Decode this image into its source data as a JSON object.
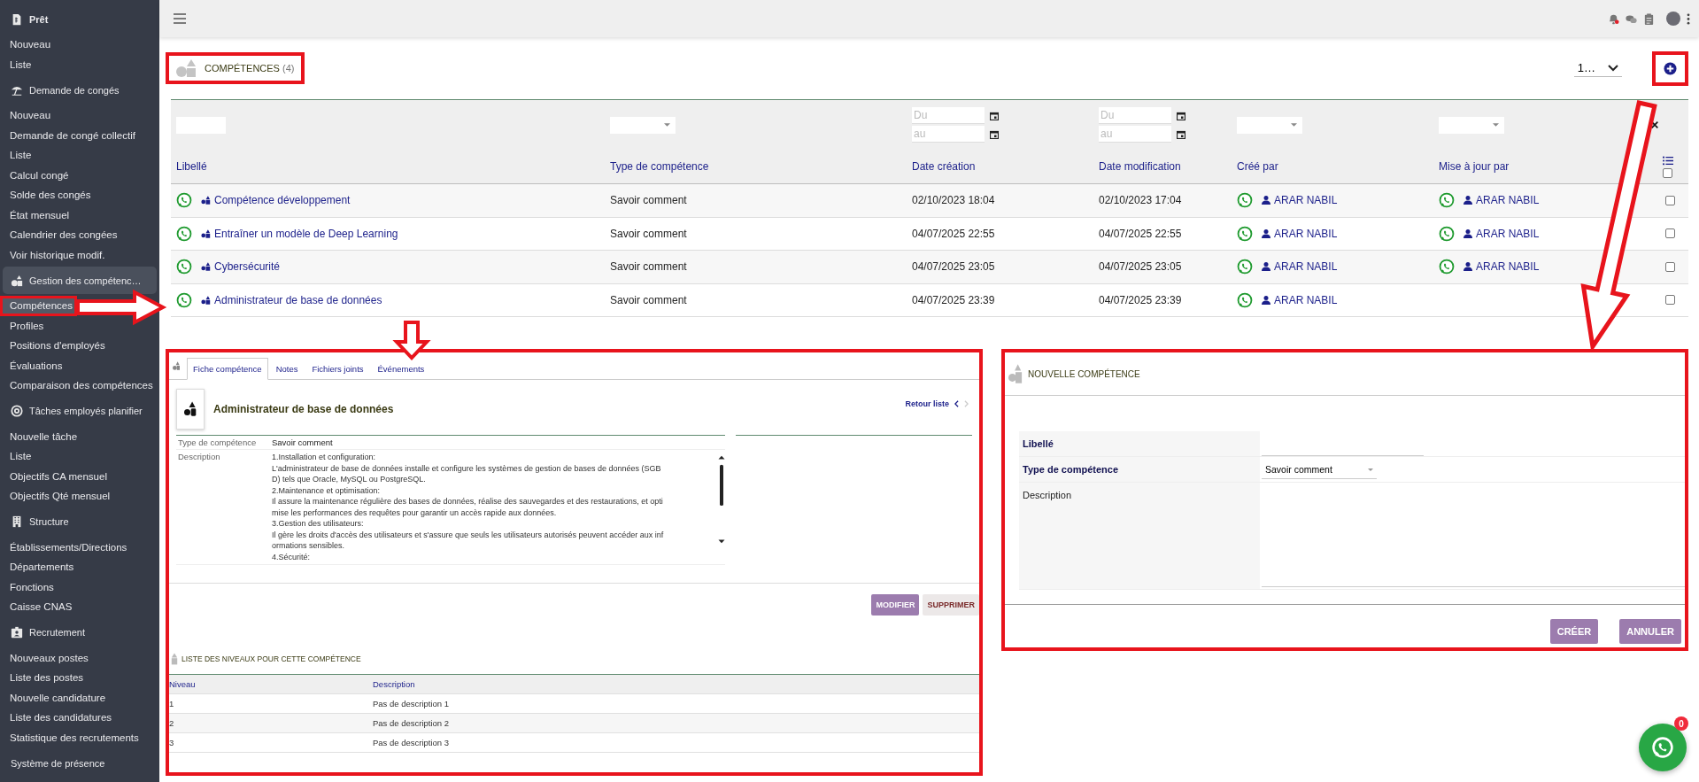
{
  "sidebar": {
    "sections": [
      {
        "kind": "document",
        "title": "Prêt",
        "active": false,
        "items": [
          {
            "label": "Nouveau",
            "selected": false
          },
          {
            "label": "Liste",
            "selected": false
          }
        ]
      },
      {
        "kind": "umbrella",
        "title": "Demande de congés",
        "active": false,
        "items": [
          {
            "label": "Nouveau",
            "selected": false
          },
          {
            "label": "Demande de congé collectif",
            "selected": false
          },
          {
            "label": "Liste",
            "selected": false
          },
          {
            "label": "Calcul congé",
            "selected": false
          },
          {
            "label": "Solde des congés",
            "selected": false
          },
          {
            "label": "État mensuel",
            "selected": false
          },
          {
            "label": "Calendrier des congées",
            "selected": false
          },
          {
            "label": "Voir historique modif.",
            "selected": false
          }
        ]
      },
      {
        "kind": "shapes",
        "title": "Gestion des compétenc…",
        "active": true,
        "items": [
          {
            "label": "Compétences",
            "selected": true
          },
          {
            "label": "Profiles",
            "selected": false
          },
          {
            "label": "Positions d'employés",
            "selected": false
          },
          {
            "label": "Évaluations",
            "selected": false
          },
          {
            "label": "Comparaison des compétences",
            "selected": false
          }
        ]
      },
      {
        "kind": "target",
        "title": "Tâches employés planifier",
        "active": false,
        "items": [
          {
            "label": "Nouvelle tâche",
            "selected": false
          },
          {
            "label": "Liste",
            "selected": false
          },
          {
            "label": "Objectifs CA mensuel",
            "selected": false
          },
          {
            "label": "Objectifs Qté mensuel",
            "selected": false
          }
        ]
      },
      {
        "kind": "building",
        "title": "Structure",
        "active": false,
        "items": [
          {
            "label": "Établissements/Directions",
            "selected": false
          },
          {
            "label": "Départements",
            "selected": false
          },
          {
            "label": "Fonctions",
            "selected": false
          },
          {
            "label": "Caisse CNAS",
            "selected": false
          }
        ]
      },
      {
        "kind": "badge",
        "title": "Recrutement",
        "active": false,
        "items": [
          {
            "label": "Nouveaux postes",
            "selected": false
          },
          {
            "label": "Liste des postes",
            "selected": false
          },
          {
            "label": "Nouvelle candidature",
            "selected": false
          },
          {
            "label": "Liste des candidatures",
            "selected": false
          },
          {
            "label": "Statistique des recrutements",
            "selected": false
          }
        ]
      },
      {
        "kind": "none",
        "title": "Système de présence",
        "active": false
      }
    ]
  },
  "header": {
    "title": "COMPÉTENCES",
    "count": "(4)",
    "pager": "1…"
  },
  "filters": [
    {
      "kind": "text"
    },
    {
      "kind": "select"
    },
    {
      "kind": "daterange",
      "fields": [
        {
          "placeholder": "Du"
        },
        {
          "placeholder": "au"
        }
      ]
    },
    {
      "kind": "daterange",
      "fields": [
        {
          "placeholder": "Du"
        },
        {
          "placeholder": "au"
        }
      ]
    },
    {
      "kind": "select"
    },
    {
      "kind": "select"
    }
  ],
  "all_checked": false,
  "columns": [
    "Libellé",
    "Type de compétence",
    "Date création",
    "Date modification",
    "Créé par",
    "Mise à jour par"
  ],
  "rows": [
    {
      "label": "Compétence développement",
      "type": "Savoir comment",
      "created": "02/10/2023 18:04",
      "modified": "02/10/2023 17:04",
      "created_by": "ARAR NABIL",
      "updated_by": "ARAR NABIL",
      "checked": false
    },
    {
      "label": "Entraîner un modèle de Deep Learning",
      "type": "Savoir comment",
      "created": "04/07/2025 22:55",
      "modified": "04/07/2025 22:55",
      "created_by": "ARAR NABIL",
      "updated_by": "ARAR NABIL",
      "checked": false
    },
    {
      "label": "Cybersécurité",
      "type": "Savoir comment",
      "created": "04/07/2025 23:05",
      "modified": "04/07/2025 23:05",
      "created_by": "ARAR NABIL",
      "updated_by": "ARAR NABIL",
      "checked": false
    },
    {
      "label": "Administrateur de base de données",
      "type": "Savoir comment",
      "created": "04/07/2025 23:39",
      "modified": "04/07/2025 23:39",
      "created_by": "ARAR NABIL",
      "checked": false
    }
  ],
  "detail": {
    "tabs": [
      {
        "label": "Fiche compétence",
        "selected": true
      },
      {
        "label": "Notes",
        "selected": false
      },
      {
        "label": "Fichiers joints",
        "selected": false
      },
      {
        "label": "Événements",
        "selected": false
      }
    ],
    "title": "Administrateur de base de données",
    "back_link": "Retour liste",
    "fields": [
      {
        "label": "Type de compétence",
        "value": "Savoir comment"
      }
    ],
    "description_label": "Description",
    "description_lines": [
      "1.Installation et configuration:",
      "L'administrateur de base de données installe et configure les systèmes de gestion de bases de données (SGB",
      "D) tels que Oracle, MySQL ou PostgreSQL.",
      "2.Maintenance et optimisation:",
      "Il assure la maintenance régulière des bases de données, réalise des sauvegardes et des restaurations, et opti",
      "mise les performances des requêtes pour garantir un accès rapide aux données.",
      "3.Gestion des utilisateurs:",
      "Il gère les droits d'accès des utilisateurs et s'assure que seuls les utilisateurs autorisés peuvent accéder aux inf",
      "ormations sensibles.",
      "4.Sécurité:"
    ],
    "buttons": [
      {
        "label": "MODIFIER",
        "kind": "primary"
      },
      {
        "label": "SUPPRIMER",
        "kind": "secondary"
      }
    ],
    "levels_title": "LISTE DES NIVEAUX POUR CETTE COMPÉTENCE",
    "levels_columns": [
      "Niveau",
      "Description"
    ],
    "levels": [
      {
        "level": "1",
        "description": "Pas de description 1"
      },
      {
        "level": "2",
        "description": "Pas de description 2"
      },
      {
        "level": "3",
        "description": "Pas de description 3"
      }
    ]
  },
  "form": {
    "title": "NOUVELLE COMPÉTENCE",
    "fields": [
      {
        "kind": "input",
        "label": "Libellé",
        "required": true
      },
      {
        "kind": "select",
        "label": "Type de compétence",
        "value": "Savoir comment",
        "required": true
      },
      {
        "kind": "textarea",
        "label": "Description",
        "required": false
      }
    ],
    "buttons": [
      {
        "label": "CRÉER",
        "kind": "primary"
      },
      {
        "label": "ANNULER",
        "kind": "primary"
      }
    ]
  },
  "chat_fab": {
    "badge": "0"
  }
}
